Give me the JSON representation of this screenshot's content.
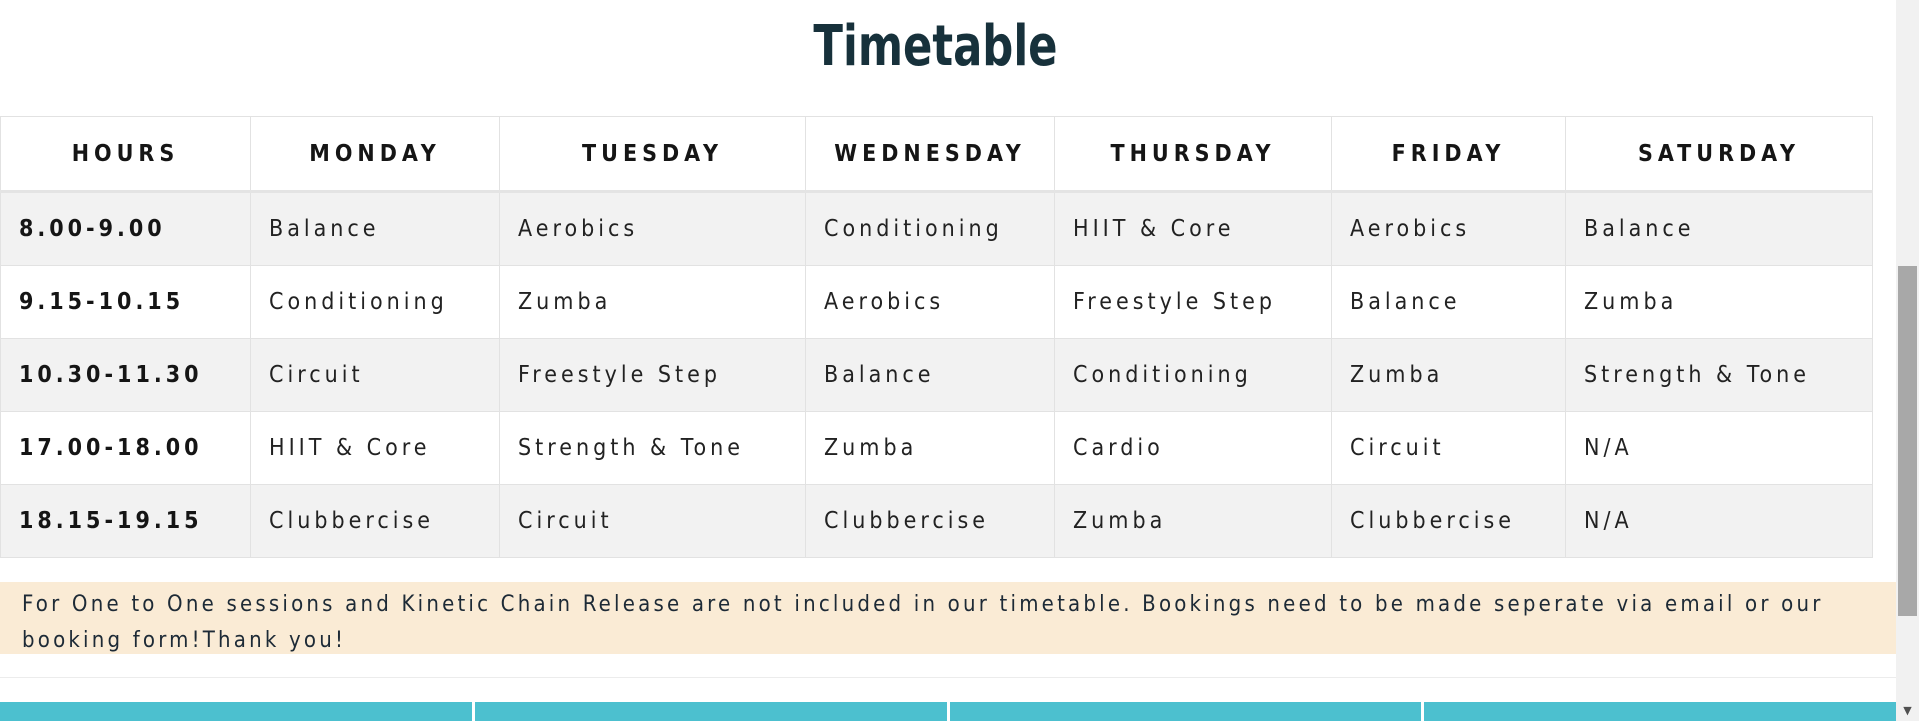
{
  "title": "Timetable",
  "table": {
    "headers": [
      "HOURS",
      "MONDAY",
      "TUESDAY",
      "WEDNESDAY",
      "THURSDAY",
      "FRIDAY",
      "SATURDAY"
    ],
    "rows": [
      [
        "8.00-9.00",
        "Balance",
        "Aerobics",
        "Conditioning",
        "HIIT & Core",
        "Aerobics",
        "Balance"
      ],
      [
        "9.15-10.15",
        "Conditioning",
        "Zumba",
        "Aerobics",
        "Freestyle Step",
        "Balance",
        "Zumba"
      ],
      [
        "10.30-11.30",
        "Circuit",
        "Freestyle Step",
        "Balance",
        "Conditioning",
        "Zumba",
        "Strength & Tone"
      ],
      [
        "17.00-18.00",
        "HIIT & Core",
        "Strength & Tone",
        "Zumba",
        "Cardio",
        "Circuit",
        "N/A"
      ],
      [
        "18.15-19.15",
        "Clubbercise",
        "Circuit",
        "Clubbercise",
        "Zumba",
        "Clubbercise",
        "N/A"
      ]
    ]
  },
  "notice": {
    "line1": "For One to One sessions and Kinetic Chain Release are not included in our timetable. Bookings need to be made seperate via email or our",
    "line2": "booking form!Thank you!"
  },
  "scrollbar": {
    "down_arrow": "▼"
  },
  "colors": {
    "title": "#17313b",
    "notice_bg": "#faebd5",
    "accent_teal": "#4cc0cf"
  }
}
